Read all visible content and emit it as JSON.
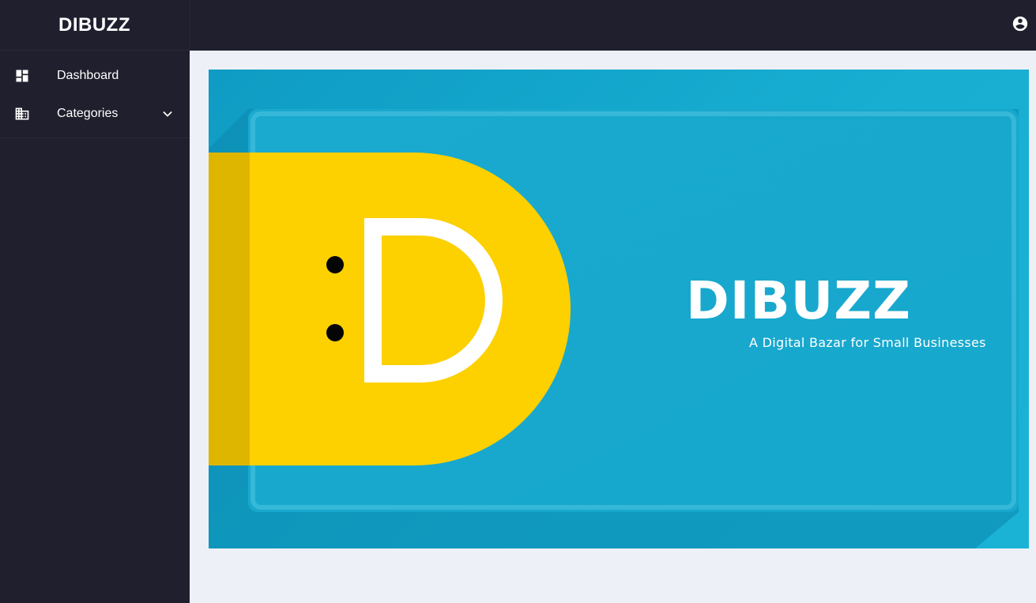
{
  "app": {
    "brand": "DIBUZZ"
  },
  "sidebar": {
    "items": [
      {
        "label": "Dashboard",
        "icon": "dashboard-icon"
      },
      {
        "label": "Categories",
        "icon": "building-icon",
        "expandable": true
      }
    ]
  },
  "topbar": {
    "account_icon": "account-circle-icon"
  },
  "banner": {
    "title": "DIBUZZ",
    "tagline": "A Digital Bazar for Small Businesses",
    "colors": {
      "background": "#17aed2",
      "logo_yellow": "#fdd000",
      "dark_navy": "#1f1f2e"
    }
  }
}
